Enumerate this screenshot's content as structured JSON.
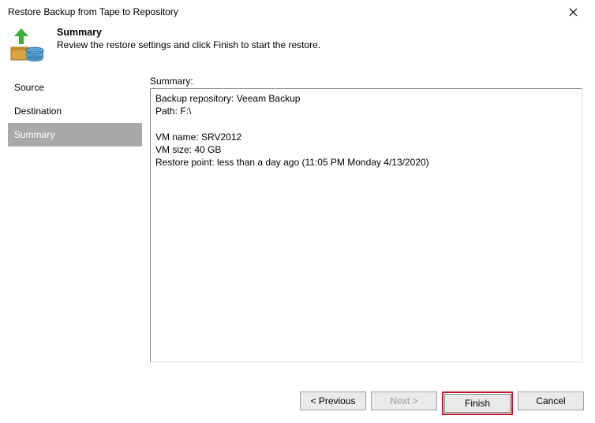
{
  "window": {
    "title": "Restore Backup from Tape to Repository",
    "close_tooltip": "Close"
  },
  "header": {
    "heading": "Summary",
    "subtext": "Review the restore settings and click Finish to start the restore."
  },
  "sidebar": {
    "items": [
      {
        "label": "Source",
        "selected": false
      },
      {
        "label": "Destination",
        "selected": false
      },
      {
        "label": "Summary",
        "selected": true
      }
    ]
  },
  "main": {
    "label": "Summary:",
    "summary_text": "Backup repository: Veeam Backup\nPath: F:\\\n\nVM name: SRV2012\nVM size: 40 GB\nRestore point: less than a day ago (11:05 PM Monday 4/13/2020)"
  },
  "buttons": {
    "previous": "< Previous",
    "next": "Next >",
    "finish": "Finish",
    "cancel": "Cancel"
  }
}
